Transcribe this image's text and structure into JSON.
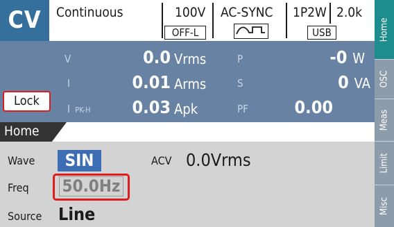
{
  "status": {
    "mode": "CV",
    "output_mode": "Continuous",
    "range": "100V",
    "signal_source": "AC-SYNC",
    "wiring": "1P2W",
    "capacity": "2.0k",
    "output_state": "OFF-L",
    "interface": "USB",
    "waveform_icon": "ac-sync-waveform-icon"
  },
  "measurements": {
    "voltage": {
      "label": "V",
      "value": "0.0",
      "unit": "Vrms"
    },
    "current": {
      "label": "I",
      "value": "0.01",
      "unit": "Arms"
    },
    "peak_current": {
      "label": "I",
      "sub": "PK-H",
      "value": "0.03",
      "unit": "Apk"
    },
    "power": {
      "label": "P",
      "value": "-0",
      "unit": "W"
    },
    "apparent_power": {
      "label": "S",
      "value": "0",
      "unit": "VA"
    },
    "power_factor": {
      "label": "PF",
      "value": "0.00"
    }
  },
  "lock": {
    "label": "Lock"
  },
  "home": {
    "title": "Home",
    "wave": {
      "label": "Wave",
      "value": "SIN"
    },
    "acv": {
      "label": "ACV",
      "value": "0.0Vrms"
    },
    "freq": {
      "label": "Freq",
      "value": "50.0Hz"
    },
    "source": {
      "label": "Source",
      "value": "Line"
    }
  },
  "side_tabs": [
    {
      "label": "Home",
      "active": true
    },
    {
      "label": "OSC",
      "active": false
    },
    {
      "label": "Meas",
      "active": false
    },
    {
      "label": "Limit",
      "active": false
    },
    {
      "label": "Misc",
      "active": false
    }
  ],
  "colors": {
    "mode_bg": "#356f9c",
    "meas_bg": "#6882a3",
    "settings_bg": "#d3d3d3",
    "highlight_red": "#e01b1b",
    "wave_highlight": "#3d6db4",
    "active_tab": "#1e8d8d"
  }
}
